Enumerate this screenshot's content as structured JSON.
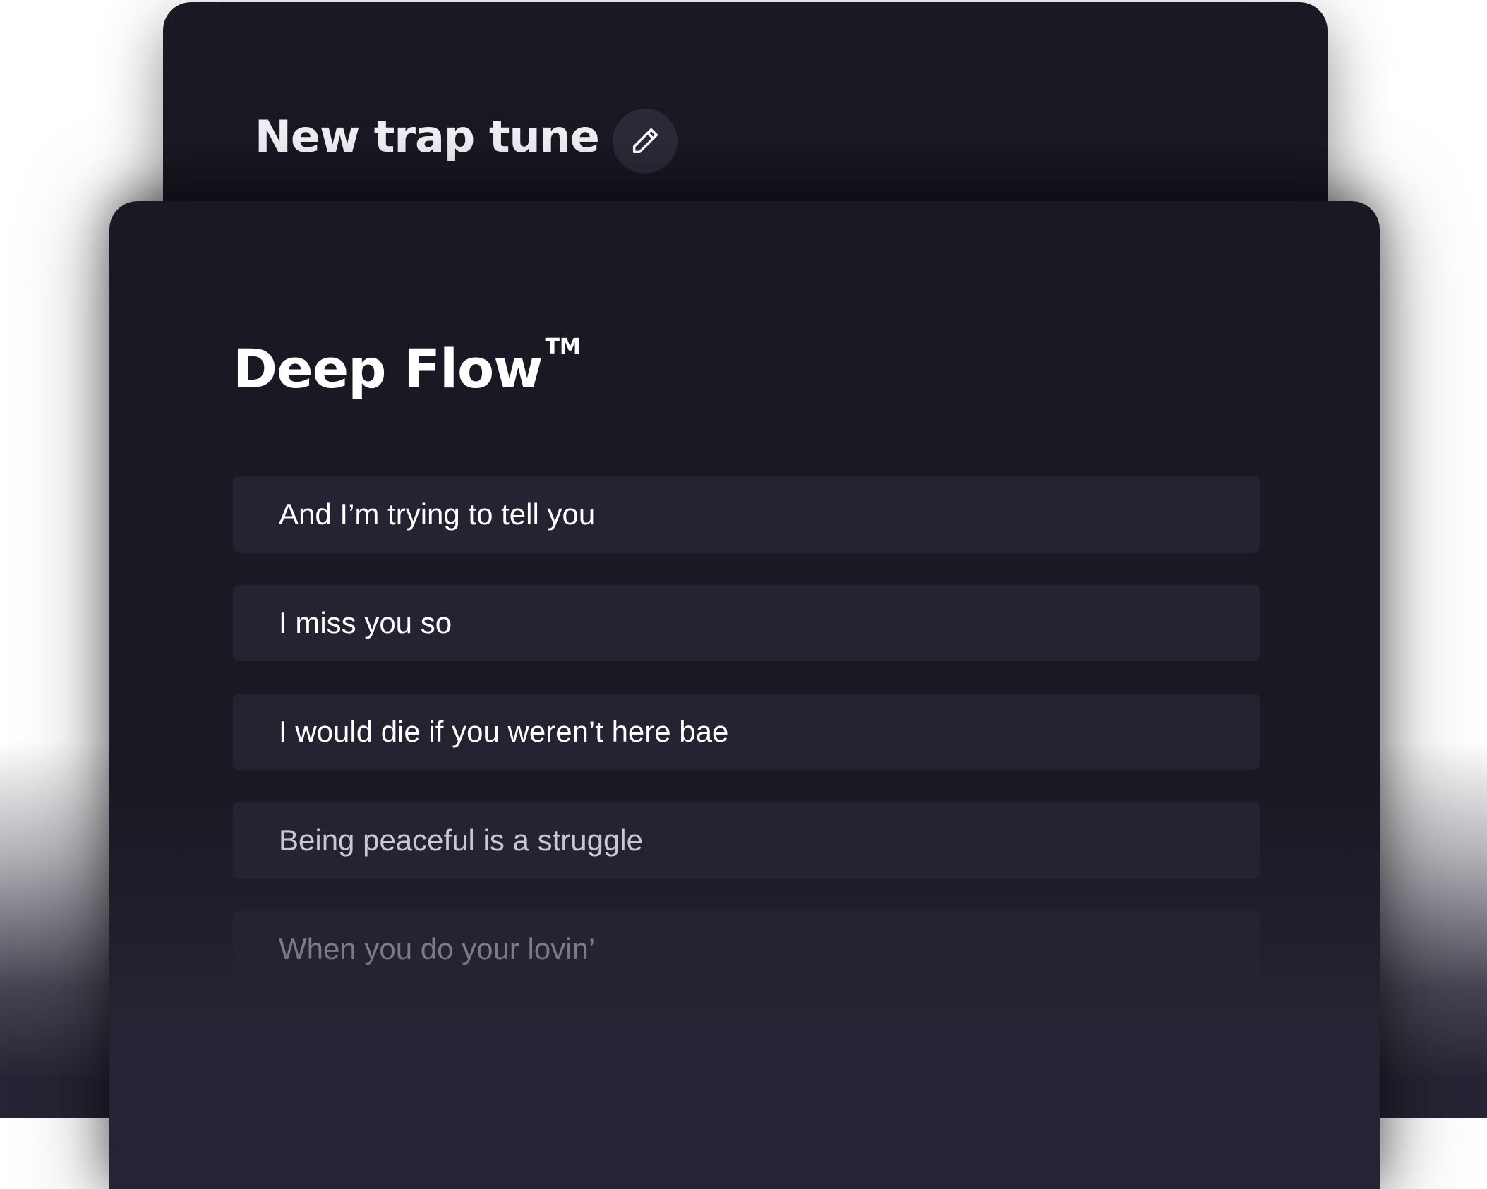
{
  "project": {
    "title": "New trap tune",
    "edit_icon": "pencil-icon"
  },
  "editor": {
    "title": "Deep Flow",
    "trademark": "TM",
    "lines": [
      {
        "text": "And I’m trying to tell you",
        "color": "#ffffff"
      },
      {
        "text": "I miss you so",
        "color": "#ffffff"
      },
      {
        "text": "I would die if you weren’t here bae",
        "color": "#ffffff"
      },
      {
        "text": "Being peaceful is a struggle",
        "color": "#c9c8d2"
      },
      {
        "text": "When you do your lovin’",
        "color": "#7e7c8c"
      }
    ]
  },
  "colors": {
    "card_background": "#191823",
    "line_background": "#242331",
    "edit_button_background": "#2b2a38",
    "fade_background": "#262434"
  }
}
